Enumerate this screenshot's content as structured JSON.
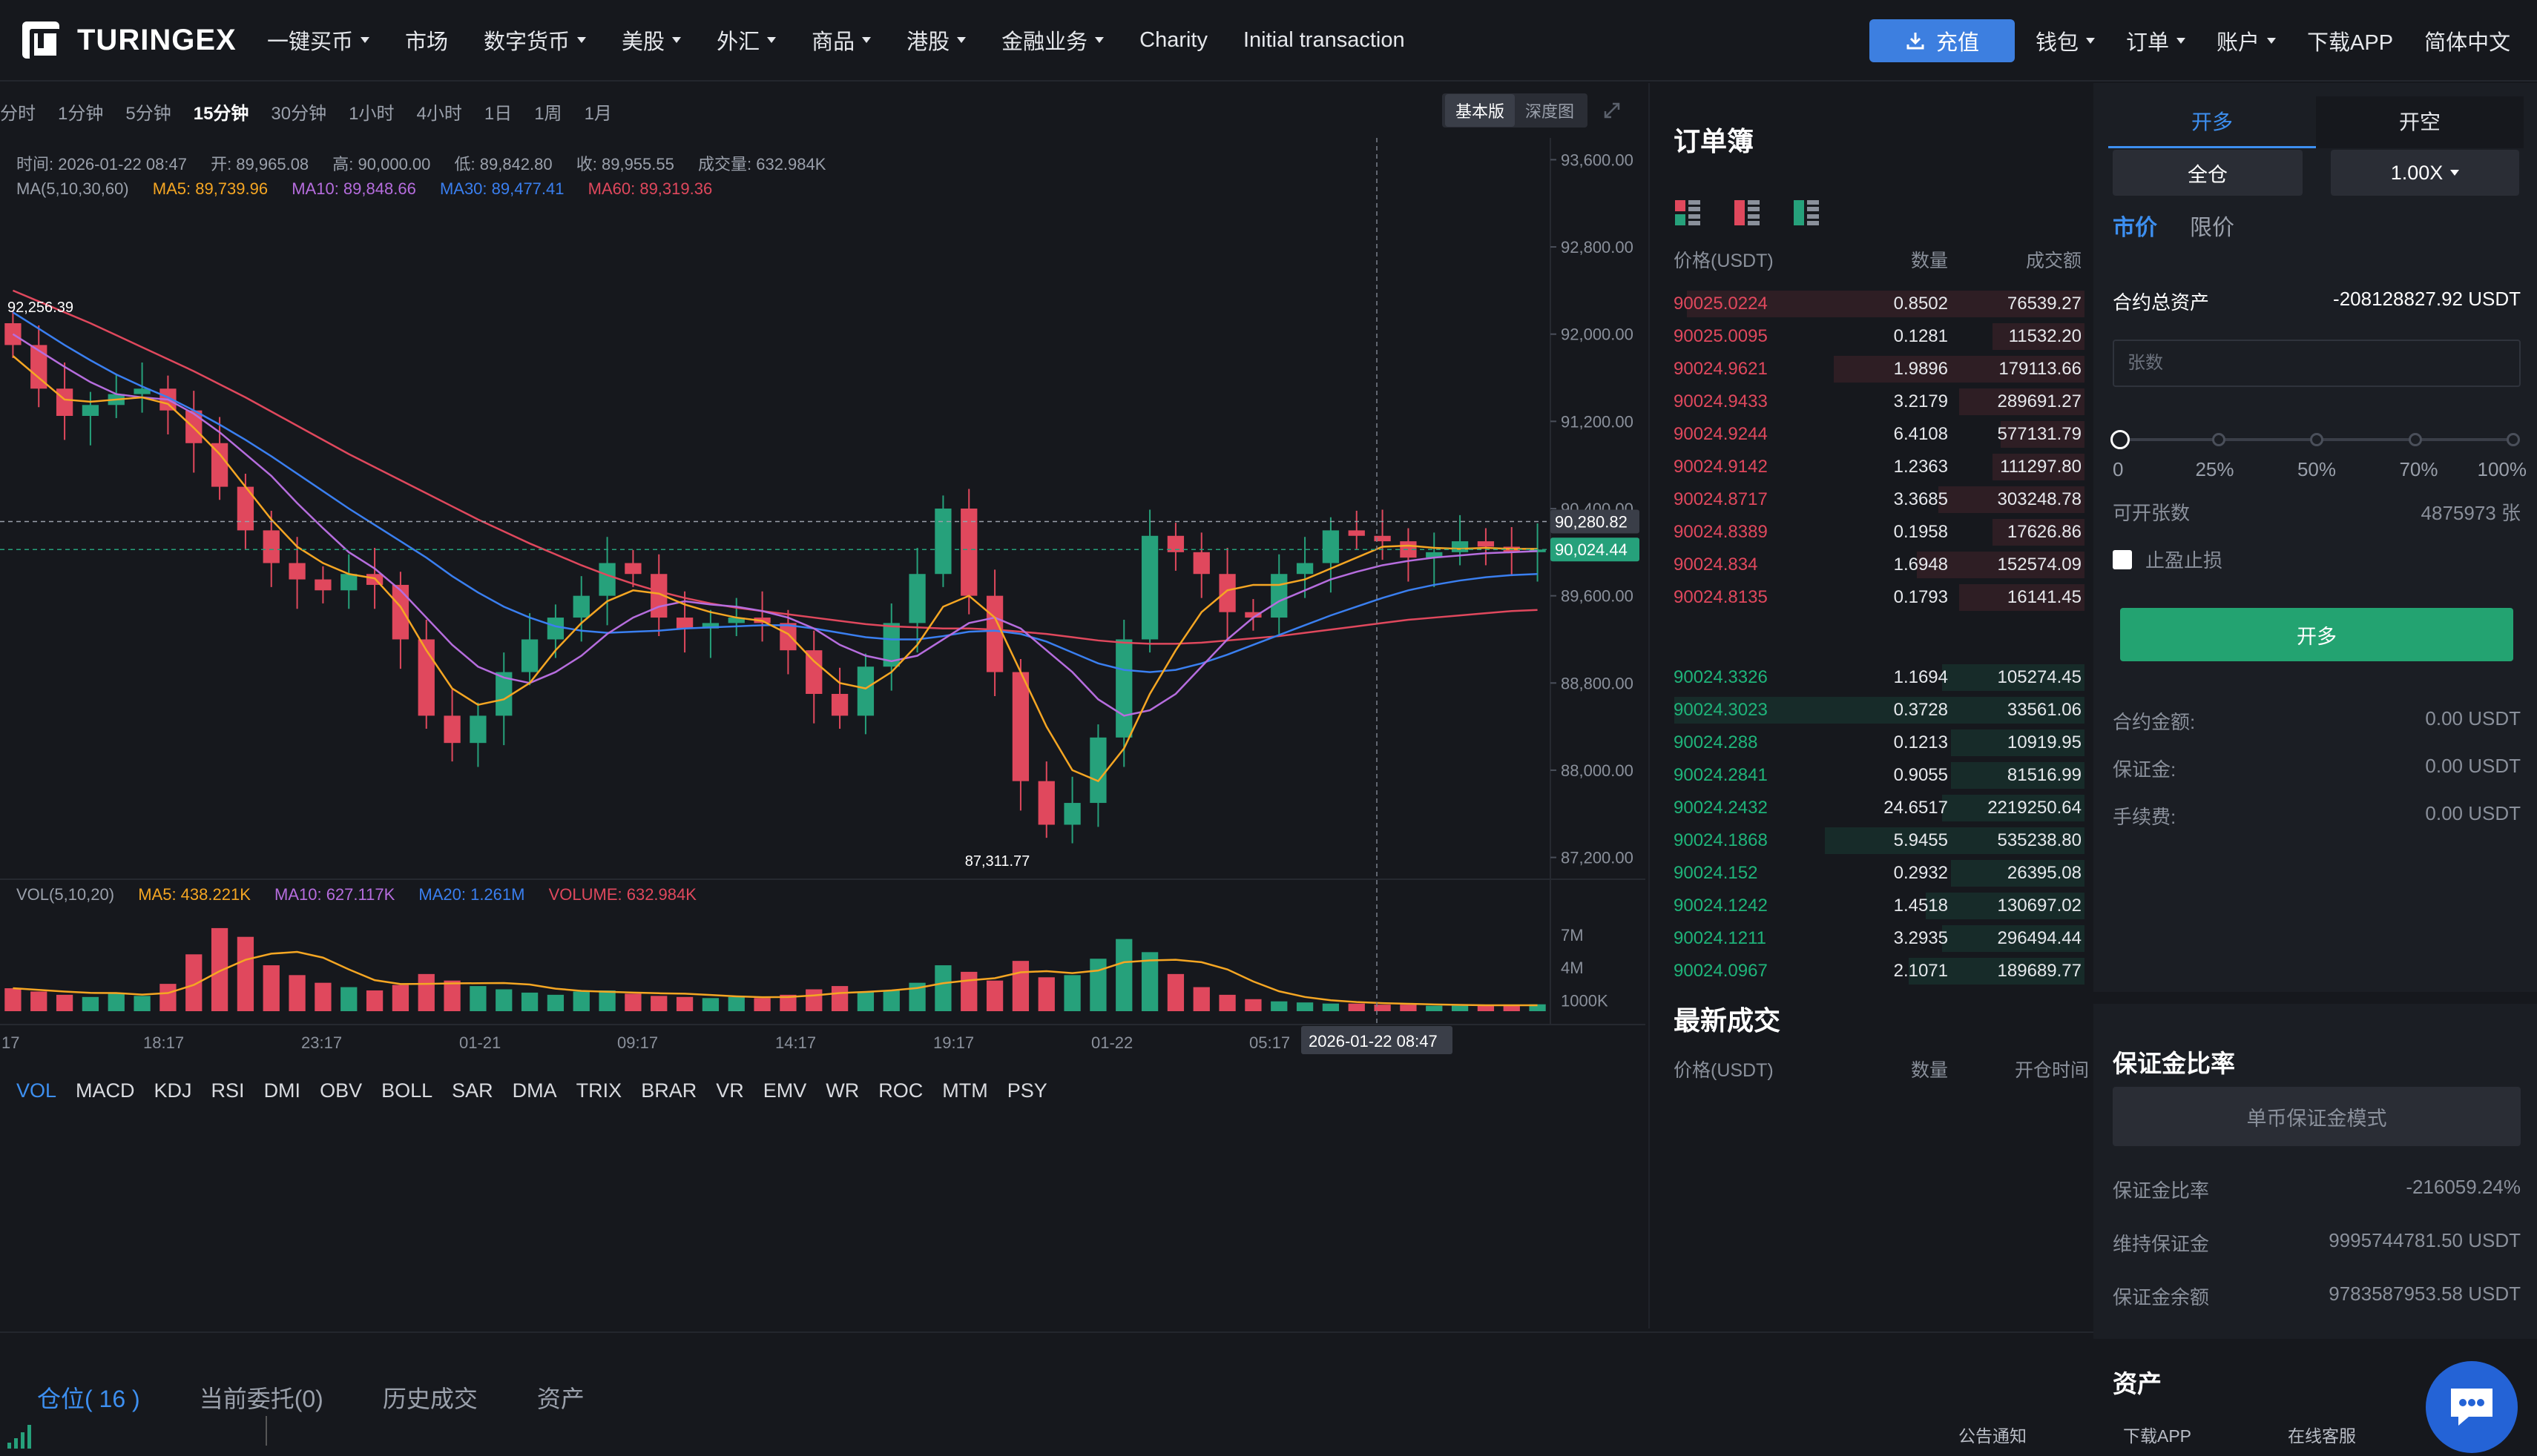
{
  "brand": {
    "name": "TURINGEX"
  },
  "nav": {
    "items": [
      {
        "label": "一键买币",
        "dropdown": true
      },
      {
        "label": "市场",
        "dropdown": false
      },
      {
        "label": "数字货币",
        "dropdown": true
      },
      {
        "label": "美股",
        "dropdown": true
      },
      {
        "label": "外汇",
        "dropdown": true
      },
      {
        "label": "商品",
        "dropdown": true
      },
      {
        "label": "港股",
        "dropdown": true
      },
      {
        "label": "金融业务",
        "dropdown": true
      },
      {
        "label": "Charity",
        "dropdown": false
      },
      {
        "label": "Initial transaction",
        "dropdown": false
      }
    ],
    "deposit_label": "充值",
    "right_items": [
      {
        "label": "钱包",
        "dropdown": true
      },
      {
        "label": "订单",
        "dropdown": true
      },
      {
        "label": "账户",
        "dropdown": true
      },
      {
        "label": "下载APP",
        "dropdown": false
      },
      {
        "label": "简体中文",
        "dropdown": false
      }
    ]
  },
  "chart_toolbar": {
    "timeframes": [
      "分时",
      "1分钟",
      "5分钟",
      "15分钟",
      "30分钟",
      "1小时",
      "4小时",
      "1日",
      "1周",
      "1月"
    ],
    "active_timeframe": "15分钟",
    "views": [
      "基本版",
      "深度图"
    ],
    "active_view": "基本版"
  },
  "ohlc": {
    "time": "时间: 2026-01-22 08:47",
    "open": "开: 89,965.08",
    "high": "高: 90,000.00",
    "low": "低: 89,842.80",
    "close": "收: 89,955.55",
    "volume": "成交量: 632.984K"
  },
  "ma_legend": {
    "label": "MA(5,10,30,60)",
    "ma5": "MA5: 89,739.96",
    "ma10": "MA10: 89,848.66",
    "ma30": "MA30: 89,477.41",
    "ma60": "MA60: 89,319.36"
  },
  "vol_legend": {
    "label": "VOL(5,10,20)",
    "ma5": "MA5: 438.221K",
    "ma10": "MA10: 627.117K",
    "ma20": "MA20: 1.261M",
    "volume": "VOLUME: 632.984K"
  },
  "colors": {
    "up": "#26a17b",
    "down": "#e0485d",
    "ma5": "#f5a623",
    "ma10": "#b66dde",
    "ma30": "#3a7ff0",
    "ma60": "#e0485d",
    "accent": "#3d8ff0",
    "buy_button": "#23a371"
  },
  "chart_data": {
    "type": "candlestick",
    "price_axis": [
      "93,600.00",
      "92,800.00",
      "92,000.00",
      "91,200.00",
      "90,400.00",
      "89,600.00",
      "88,800.00",
      "88,000.00",
      "87,200.00"
    ],
    "ylim": [
      87000,
      93800
    ],
    "time_axis": [
      "17",
      "18:17",
      "23:17",
      "01-21",
      "09:17",
      "14:17",
      "19:17",
      "01-22",
      "05:17"
    ],
    "crosshair_time": "2026-01-22 08:47",
    "last_price_label": "90,280.82",
    "current_price_label": "90,024.44",
    "high_marker": "92,256.39",
    "low_marker": "87,311.77",
    "volume_axis": [
      "7M",
      "4M",
      "1000K"
    ],
    "volume_max": 8000000,
    "close_series": [
      91900,
      91500,
      91250,
      91350,
      91450,
      91500,
      91300,
      91000,
      90600,
      90200,
      89900,
      89750,
      89650,
      89800,
      89700,
      89200,
      88500,
      88250,
      88500,
      88900,
      89200,
      89400,
      89600,
      89900,
      89800,
      89400,
      89300,
      89350,
      89400,
      89350,
      89100,
      88700,
      88500,
      88950,
      89350,
      89800,
      90400,
      89600,
      88900,
      87900,
      87500,
      87700,
      88300,
      89200,
      90150,
      90000,
      89800,
      89450,
      89400,
      89800,
      89900,
      90200,
      90150,
      90100,
      89950,
      90000,
      90100,
      90050,
      90000,
      90024
    ],
    "ma5_series": [
      91800,
      91600,
      91400,
      91380,
      91400,
      91420,
      91360,
      91140,
      90900,
      90600,
      90300,
      90050,
      89900,
      89800,
      89760,
      89500,
      89100,
      88750,
      88600,
      88650,
      88800,
      89100,
      89350,
      89550,
      89650,
      89620,
      89520,
      89450,
      89400,
      89370,
      89250,
      89000,
      88800,
      88750,
      88900,
      89150,
      89500,
      89600,
      89400,
      88900,
      88400,
      88000,
      87900,
      88200,
      88700,
      89100,
      89450,
      89650,
      89700,
      89700,
      89750,
      89850,
      89950,
      90050,
      90060,
      90040,
      90030,
      90040,
      90030,
      90030
    ],
    "ma10_series": [
      92000,
      91850,
      91700,
      91560,
      91450,
      91420,
      91400,
      91270,
      91100,
      90900,
      90700,
      90450,
      90220,
      90000,
      89850,
      89650,
      89400,
      89150,
      88950,
      88850,
      88800,
      88900,
      89050,
      89250,
      89400,
      89500,
      89550,
      89520,
      89500,
      89460,
      89400,
      89300,
      89150,
      89050,
      89000,
      89050,
      89200,
      89350,
      89400,
      89300,
      89100,
      88900,
      88650,
      88500,
      88550,
      88700,
      88950,
      89200,
      89400,
      89550,
      89650,
      89750,
      89820,
      89880,
      89920,
      89950,
      89970,
      89990,
      90000,
      90010
    ],
    "ma30_series": [
      92200,
      92050,
      91900,
      91760,
      91630,
      91520,
      91420,
      91300,
      91170,
      91030,
      90880,
      90720,
      90560,
      90400,
      90250,
      90100,
      89950,
      89780,
      89630,
      89500,
      89400,
      89320,
      89280,
      89260,
      89270,
      89280,
      89300,
      89310,
      89320,
      89330,
      89330,
      89300,
      89260,
      89220,
      89200,
      89200,
      89230,
      89270,
      89280,
      89250,
      89180,
      89080,
      88980,
      88920,
      88900,
      88920,
      88980,
      89060,
      89150,
      89240,
      89330,
      89420,
      89500,
      89580,
      89650,
      89700,
      89740,
      89770,
      89790,
      89800
    ],
    "ma60_series": [
      92400,
      92300,
      92200,
      92100,
      91990,
      91880,
      91770,
      91660,
      91540,
      91420,
      91290,
      91160,
      91030,
      90900,
      90780,
      90660,
      90540,
      90420,
      90300,
      90190,
      90080,
      89980,
      89880,
      89790,
      89710,
      89640,
      89580,
      89530,
      89490,
      89460,
      89430,
      89400,
      89370,
      89340,
      89320,
      89310,
      89300,
      89300,
      89290,
      89270,
      89250,
      89220,
      89190,
      89170,
      89160,
      89160,
      89170,
      89190,
      89210,
      89230,
      89260,
      89290,
      89320,
      89350,
      89380,
      89400,
      89420,
      89440,
      89460,
      89470
    ],
    "volume_series": [
      2100000,
      1800000,
      1500000,
      1300000,
      1600000,
      1400000,
      2500000,
      5200000,
      7600000,
      6800000,
      4200000,
      3300000,
      2600000,
      2200000,
      1900000,
      2400000,
      3400000,
      2800000,
      2300000,
      2000000,
      1700000,
      1500000,
      1800000,
      1900000,
      1600000,
      1400000,
      1300000,
      1200000,
      1300000,
      1200000,
      1500000,
      2000000,
      2300000,
      1800000,
      1900000,
      2600000,
      4200000,
      3600000,
      2800000,
      4600000,
      3100000,
      3300000,
      4800000,
      6600000,
      5400000,
      3400000,
      2200000,
      1500000,
      1100000,
      900000,
      800000,
      700000,
      700000,
      600000,
      600000,
      500000,
      500000,
      500000,
      600000,
      630000
    ]
  },
  "indicators": [
    "VOL",
    "MACD",
    "KDJ",
    "RSI",
    "DMI",
    "OBV",
    "BOLL",
    "SAR",
    "DMA",
    "TRIX",
    "BRAR",
    "VR",
    "EMV",
    "WR",
    "ROC",
    "MTM",
    "PSY"
  ],
  "active_indicator": "VOL",
  "orderbook": {
    "title": "订单簿",
    "headers": [
      "价格(USDT)",
      "数量",
      "成交额"
    ],
    "asks": [
      {
        "price": "90025.0224",
        "qty": "0.8502",
        "amount": "76539.27",
        "depth": 0.95
      },
      {
        "price": "90025.0095",
        "qty": "0.1281",
        "amount": "11532.20",
        "depth": 0.22
      },
      {
        "price": "90024.9621",
        "qty": "1.9896",
        "amount": "179113.66",
        "depth": 0.6
      },
      {
        "price": "90024.9433",
        "qty": "3.2179",
        "amount": "289691.27",
        "depth": 0.3
      },
      {
        "price": "90024.9244",
        "qty": "6.4108",
        "amount": "577131.79",
        "depth": 0.2
      },
      {
        "price": "90024.9142",
        "qty": "1.2363",
        "amount": "111297.80",
        "depth": 0.22
      },
      {
        "price": "90024.8717",
        "qty": "3.3685",
        "amount": "303248.78",
        "depth": 0.35
      },
      {
        "price": "90024.8389",
        "qty": "0.1958",
        "amount": "17626.86",
        "depth": 0.22
      },
      {
        "price": "90024.834",
        "qty": "1.6948",
        "amount": "152574.09",
        "depth": 0.4
      },
      {
        "price": "90024.8135",
        "qty": "0.1793",
        "amount": "16141.45",
        "depth": 0.3
      }
    ],
    "bids": [
      {
        "price": "90024.3326",
        "qty": "1.1694",
        "amount": "105274.45",
        "depth": 0.34
      },
      {
        "price": "90024.3023",
        "qty": "0.3728",
        "amount": "33561.06",
        "depth": 0.98
      },
      {
        "price": "90024.288",
        "qty": "0.1213",
        "amount": "10919.95",
        "depth": 0.32
      },
      {
        "price": "90024.2841",
        "qty": "0.9055",
        "amount": "81516.99",
        "depth": 0.32
      },
      {
        "price": "90024.2432",
        "qty": "24.6517",
        "amount": "2219250.64",
        "depth": 0.34
      },
      {
        "price": "90024.1868",
        "qty": "5.9455",
        "amount": "535238.80",
        "depth": 0.62
      },
      {
        "price": "90024.152",
        "qty": "0.2932",
        "amount": "26395.08",
        "depth": 0.32
      },
      {
        "price": "90024.1242",
        "qty": "1.4518",
        "amount": "130697.02",
        "depth": 0.38
      },
      {
        "price": "90024.1211",
        "qty": "3.2935",
        "amount": "296494.44",
        "depth": 0.34
      },
      {
        "price": "90024.0967",
        "qty": "2.1071",
        "amount": "189689.77",
        "depth": 0.42
      }
    ],
    "trades_title": "最新成交",
    "trades_headers": [
      "价格(USDT)",
      "数量",
      "开仓时间"
    ]
  },
  "trade": {
    "side_tabs": [
      "开多",
      "开空"
    ],
    "active_side": "开多",
    "margin_mode": "全仓",
    "leverage": "1.00X",
    "order_types": [
      "市价",
      "限价"
    ],
    "active_order_type": "市价",
    "total_assets_label": "合约总资产",
    "total_assets_value": "-208128827.92 USDT",
    "qty_placeholder": "张数",
    "slider_labels": [
      "0",
      "25%",
      "50%",
      "70%",
      "100%"
    ],
    "slider_value": 0,
    "openable_label": "可开张数",
    "openable_value": "4875973 张",
    "sltp_label": "止盈止损",
    "submit_label": "开多",
    "contract_amount_label": "合约金额:",
    "contract_amount_value": "0.00 USDT",
    "margin_label": "保证金:",
    "margin_value": "0.00 USDT",
    "fee_label": "手续费:",
    "fee_value": "0.00 USDT"
  },
  "margin": {
    "title": "保证金比率",
    "mode_button": "单币保证金模式",
    "ratio_label": "保证金比率",
    "ratio_value": "-216059.24%",
    "maintenance_label": "维持保证金",
    "maintenance_value": "9995744781.50 USDT",
    "balance_label": "保证金余额",
    "balance_value": "9783587953.58 USDT"
  },
  "assets_title": "资产",
  "bottom_tabs": [
    "仓位( 16 )",
    "当前委托(0)",
    "历史成交",
    "资产"
  ],
  "active_bottom_tab": "仓位( 16 )",
  "footer_links": [
    "公告通知",
    "下载APP",
    "在线客服"
  ]
}
